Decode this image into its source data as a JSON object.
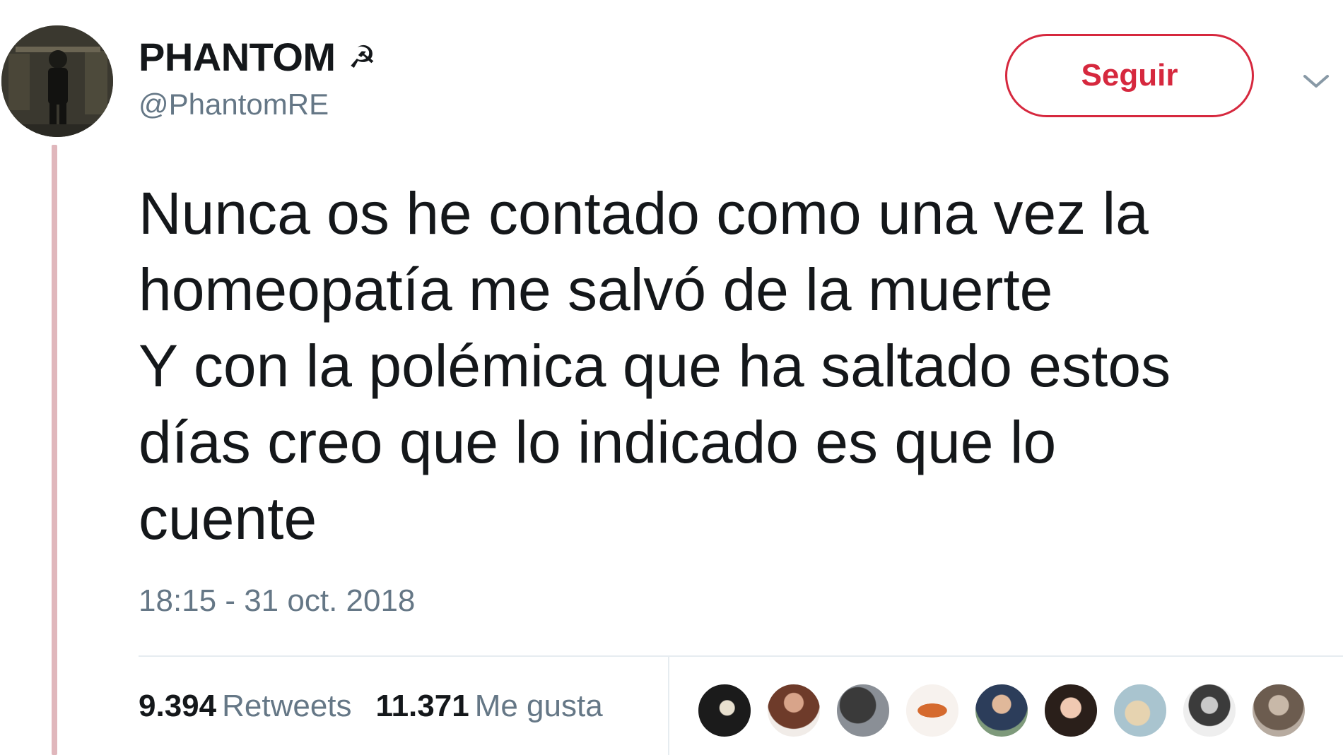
{
  "user": {
    "display_name": "PHANTOM",
    "name_emoji": "☭",
    "handle": "@PhantomRE"
  },
  "actions": {
    "follow_label": "Seguir",
    "more_icon": "chevron-down-icon"
  },
  "tweet": {
    "lines": [
      "Nunca os he contado como una vez la",
      "homeopatía me salvó de la muerte",
      "Y con la polémica que ha saltado estos",
      "días creo que lo indicado es que lo",
      "cuente"
    ],
    "timestamp": "18:15 - 31 oct. 2018"
  },
  "stats": {
    "retweets_count": "9.394",
    "retweets_label": "Retweets",
    "likes_count": "11.371",
    "likes_label": "Me gusta"
  },
  "colors": {
    "accent": "#d6283e",
    "secondary_text": "#657786",
    "thread_line": "#e0b7bc"
  }
}
